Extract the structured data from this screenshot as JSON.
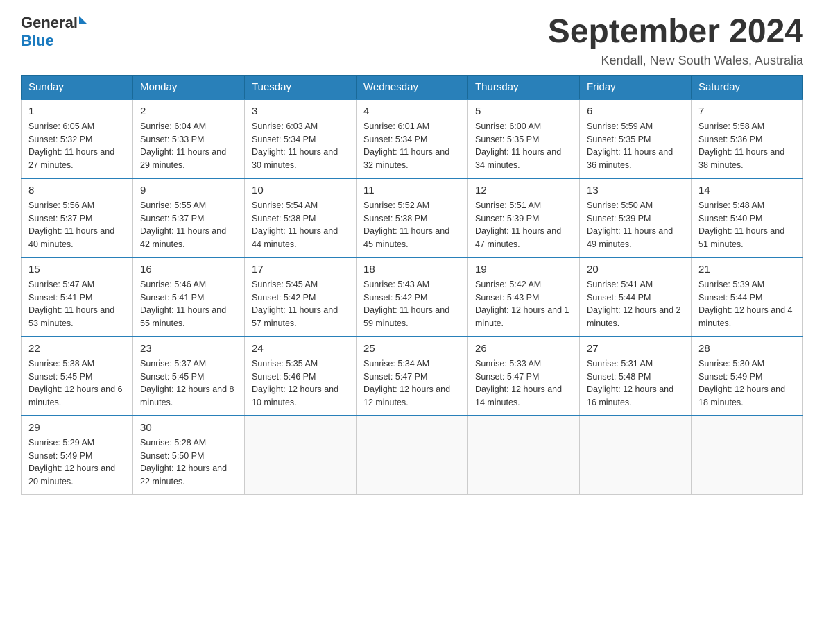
{
  "header": {
    "logo": {
      "general": "General",
      "blue": "Blue"
    },
    "title": "September 2024",
    "subtitle": "Kendall, New South Wales, Australia"
  },
  "calendar": {
    "days_of_week": [
      "Sunday",
      "Monday",
      "Tuesday",
      "Wednesday",
      "Thursday",
      "Friday",
      "Saturday"
    ],
    "weeks": [
      [
        {
          "day": "1",
          "sunrise": "6:05 AM",
          "sunset": "5:32 PM",
          "daylight": "11 hours and 27 minutes."
        },
        {
          "day": "2",
          "sunrise": "6:04 AM",
          "sunset": "5:33 PM",
          "daylight": "11 hours and 29 minutes."
        },
        {
          "day": "3",
          "sunrise": "6:03 AM",
          "sunset": "5:34 PM",
          "daylight": "11 hours and 30 minutes."
        },
        {
          "day": "4",
          "sunrise": "6:01 AM",
          "sunset": "5:34 PM",
          "daylight": "11 hours and 32 minutes."
        },
        {
          "day": "5",
          "sunrise": "6:00 AM",
          "sunset": "5:35 PM",
          "daylight": "11 hours and 34 minutes."
        },
        {
          "day": "6",
          "sunrise": "5:59 AM",
          "sunset": "5:35 PM",
          "daylight": "11 hours and 36 minutes."
        },
        {
          "day": "7",
          "sunrise": "5:58 AM",
          "sunset": "5:36 PM",
          "daylight": "11 hours and 38 minutes."
        }
      ],
      [
        {
          "day": "8",
          "sunrise": "5:56 AM",
          "sunset": "5:37 PM",
          "daylight": "11 hours and 40 minutes."
        },
        {
          "day": "9",
          "sunrise": "5:55 AM",
          "sunset": "5:37 PM",
          "daylight": "11 hours and 42 minutes."
        },
        {
          "day": "10",
          "sunrise": "5:54 AM",
          "sunset": "5:38 PM",
          "daylight": "11 hours and 44 minutes."
        },
        {
          "day": "11",
          "sunrise": "5:52 AM",
          "sunset": "5:38 PM",
          "daylight": "11 hours and 45 minutes."
        },
        {
          "day": "12",
          "sunrise": "5:51 AM",
          "sunset": "5:39 PM",
          "daylight": "11 hours and 47 minutes."
        },
        {
          "day": "13",
          "sunrise": "5:50 AM",
          "sunset": "5:39 PM",
          "daylight": "11 hours and 49 minutes."
        },
        {
          "day": "14",
          "sunrise": "5:48 AM",
          "sunset": "5:40 PM",
          "daylight": "11 hours and 51 minutes."
        }
      ],
      [
        {
          "day": "15",
          "sunrise": "5:47 AM",
          "sunset": "5:41 PM",
          "daylight": "11 hours and 53 minutes."
        },
        {
          "day": "16",
          "sunrise": "5:46 AM",
          "sunset": "5:41 PM",
          "daylight": "11 hours and 55 minutes."
        },
        {
          "day": "17",
          "sunrise": "5:45 AM",
          "sunset": "5:42 PM",
          "daylight": "11 hours and 57 minutes."
        },
        {
          "day": "18",
          "sunrise": "5:43 AM",
          "sunset": "5:42 PM",
          "daylight": "11 hours and 59 minutes."
        },
        {
          "day": "19",
          "sunrise": "5:42 AM",
          "sunset": "5:43 PM",
          "daylight": "12 hours and 1 minute."
        },
        {
          "day": "20",
          "sunrise": "5:41 AM",
          "sunset": "5:44 PM",
          "daylight": "12 hours and 2 minutes."
        },
        {
          "day": "21",
          "sunrise": "5:39 AM",
          "sunset": "5:44 PM",
          "daylight": "12 hours and 4 minutes."
        }
      ],
      [
        {
          "day": "22",
          "sunrise": "5:38 AM",
          "sunset": "5:45 PM",
          "daylight": "12 hours and 6 minutes."
        },
        {
          "day": "23",
          "sunrise": "5:37 AM",
          "sunset": "5:45 PM",
          "daylight": "12 hours and 8 minutes."
        },
        {
          "day": "24",
          "sunrise": "5:35 AM",
          "sunset": "5:46 PM",
          "daylight": "12 hours and 10 minutes."
        },
        {
          "day": "25",
          "sunrise": "5:34 AM",
          "sunset": "5:47 PM",
          "daylight": "12 hours and 12 minutes."
        },
        {
          "day": "26",
          "sunrise": "5:33 AM",
          "sunset": "5:47 PM",
          "daylight": "12 hours and 14 minutes."
        },
        {
          "day": "27",
          "sunrise": "5:31 AM",
          "sunset": "5:48 PM",
          "daylight": "12 hours and 16 minutes."
        },
        {
          "day": "28",
          "sunrise": "5:30 AM",
          "sunset": "5:49 PM",
          "daylight": "12 hours and 18 minutes."
        }
      ],
      [
        {
          "day": "29",
          "sunrise": "5:29 AM",
          "sunset": "5:49 PM",
          "daylight": "12 hours and 20 minutes."
        },
        {
          "day": "30",
          "sunrise": "5:28 AM",
          "sunset": "5:50 PM",
          "daylight": "12 hours and 22 minutes."
        },
        null,
        null,
        null,
        null,
        null
      ]
    ]
  }
}
